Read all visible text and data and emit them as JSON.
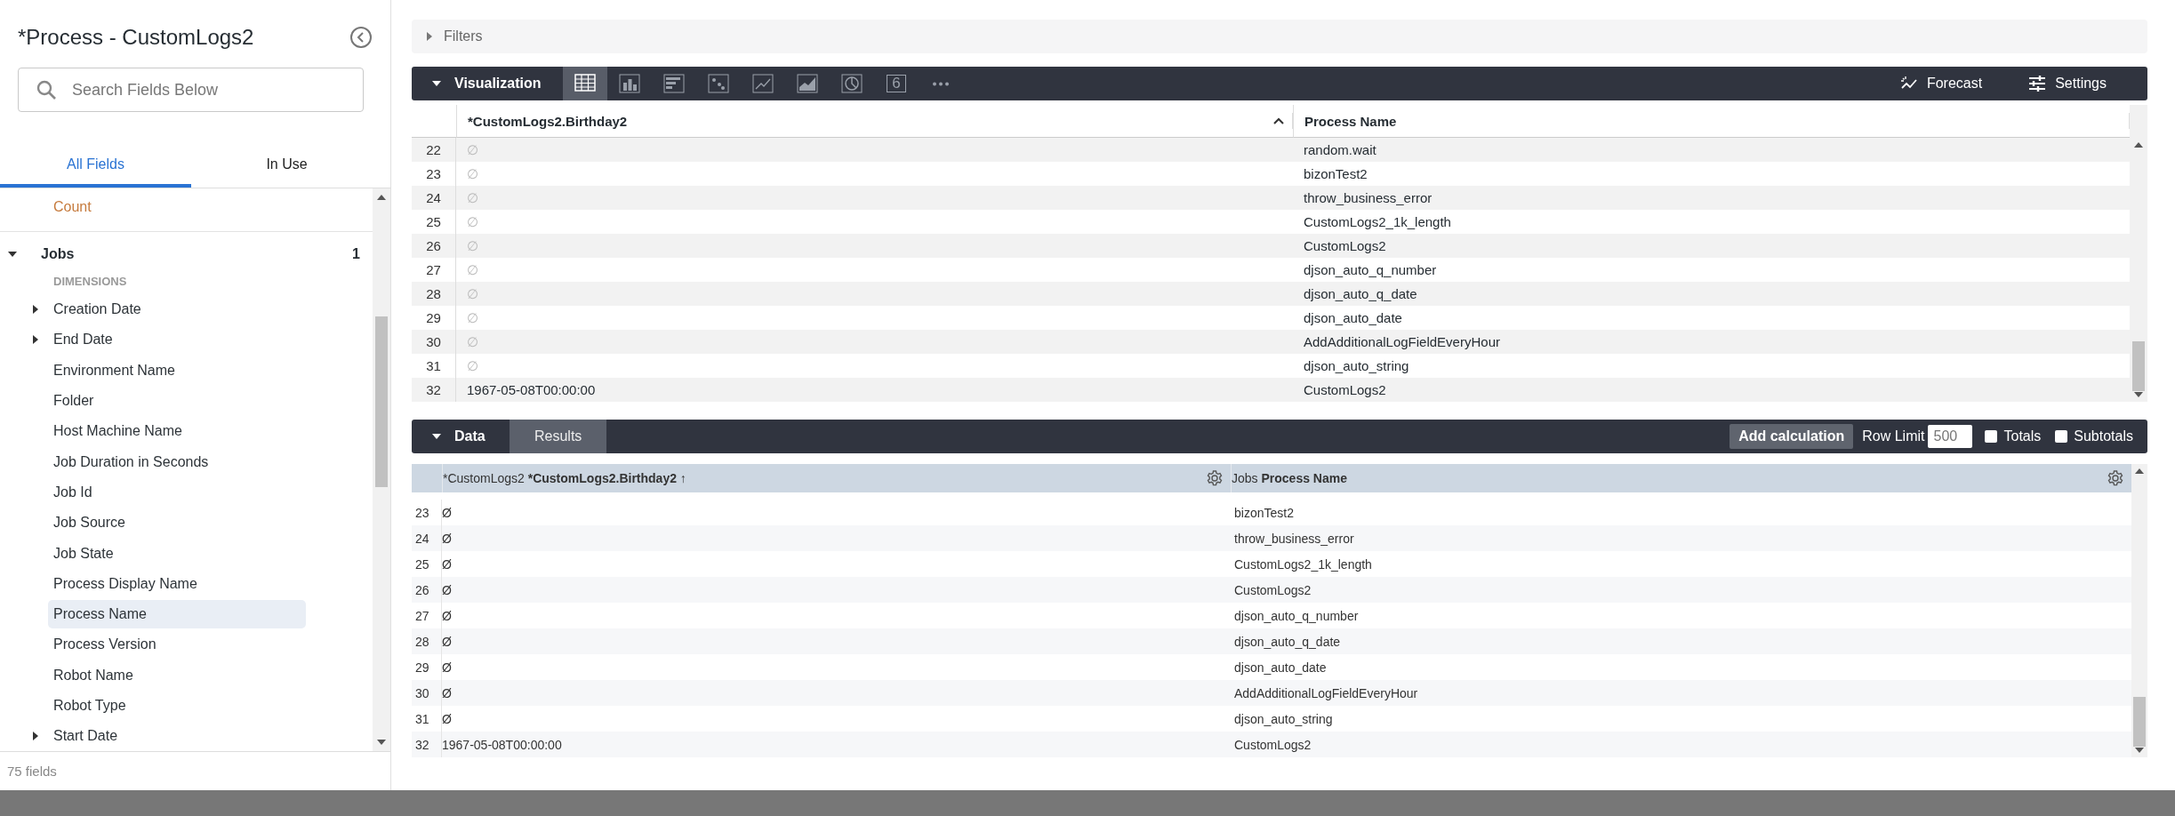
{
  "sidebar": {
    "title": "*Process - CustomLogs2",
    "search": {
      "placeholder": "Search Fields Below"
    },
    "tabs": [
      {
        "label": "All Fields",
        "selected": true
      },
      {
        "label": "In Use",
        "selected": false
      }
    ],
    "measure": "Count",
    "group": {
      "name": "Jobs",
      "count": "1",
      "expanded": true,
      "section": "DIMENSIONS",
      "items": [
        {
          "label": "Creation Date",
          "expandable": true,
          "selected": false
        },
        {
          "label": "End Date",
          "expandable": true,
          "selected": false
        },
        {
          "label": "Environment Name",
          "expandable": false,
          "selected": false
        },
        {
          "label": "Folder",
          "expandable": false,
          "selected": false
        },
        {
          "label": "Host Machine Name",
          "expandable": false,
          "selected": false
        },
        {
          "label": "Job Duration in Seconds",
          "expandable": false,
          "selected": false
        },
        {
          "label": "Job Id",
          "expandable": false,
          "selected": false
        },
        {
          "label": "Job Source",
          "expandable": false,
          "selected": false
        },
        {
          "label": "Job State",
          "expandable": false,
          "selected": false
        },
        {
          "label": "Process Display Name",
          "expandable": false,
          "selected": false
        },
        {
          "label": "Process Name",
          "expandable": false,
          "selected": true
        },
        {
          "label": "Process Version",
          "expandable": false,
          "selected": false
        },
        {
          "label": "Robot Name",
          "expandable": false,
          "selected": false
        },
        {
          "label": "Robot Type",
          "expandable": false,
          "selected": false
        },
        {
          "label": "Start Date",
          "expandable": true,
          "selected": false
        }
      ]
    },
    "footer": "75 fields"
  },
  "filters": {
    "label": "Filters",
    "expanded": false
  },
  "visualization": {
    "label": "Visualization",
    "expanded": true,
    "chart_types": [
      {
        "kind": "table",
        "selected": true
      },
      {
        "kind": "column",
        "selected": false
      },
      {
        "kind": "bar",
        "selected": false
      },
      {
        "kind": "scatter",
        "selected": false
      },
      {
        "kind": "line",
        "selected": false
      },
      {
        "kind": "area",
        "selected": false
      },
      {
        "kind": "pie",
        "selected": false
      },
      {
        "kind": "single_value",
        "label": "6",
        "selected": false
      },
      {
        "kind": "more",
        "selected": false
      }
    ],
    "actions": [
      {
        "kind": "forecast",
        "label": "Forecast"
      },
      {
        "kind": "settings",
        "label": "Settings"
      }
    ],
    "table": {
      "columns": [
        {
          "label": "*CustomLogs2.Birthday2",
          "sorted": true
        },
        {
          "label": "Process Name",
          "sorted": false
        }
      ],
      "rows": [
        {
          "index": "22",
          "column_1": "∅",
          "column_2": "random.wait"
        },
        {
          "index": "23",
          "column_1": "∅",
          "column_2": "bizonTest2"
        },
        {
          "index": "24",
          "column_1": "∅",
          "column_2": "throw_business_error"
        },
        {
          "index": "25",
          "column_1": "∅",
          "column_2": "CustomLogs2_1k_length"
        },
        {
          "index": "26",
          "column_1": "∅",
          "column_2": "CustomLogs2"
        },
        {
          "index": "27",
          "column_1": "∅",
          "column_2": "djson_auto_q_number"
        },
        {
          "index": "28",
          "column_1": "∅",
          "column_2": "djson_auto_q_date"
        },
        {
          "index": "29",
          "column_1": "∅",
          "column_2": "djson_auto_date"
        },
        {
          "index": "30",
          "column_1": "∅",
          "column_2": "AddAdditionalLogFieldEveryHour"
        },
        {
          "index": "31",
          "column_1": "∅",
          "column_2": "djson_auto_string"
        },
        {
          "index": "32",
          "column_1": "1967-05-08T00:00:00",
          "column_2": "CustomLogs2"
        }
      ]
    }
  },
  "data": {
    "label": "Data",
    "expanded": true,
    "tabs": [
      {
        "label": "Results",
        "selected": true
      }
    ],
    "add_calculation": "Add calculation",
    "row_limit": {
      "label": "Row Limit",
      "value": "500"
    },
    "options": [
      {
        "label": "Totals",
        "checked": false
      },
      {
        "label": "Subtotals",
        "checked": false
      }
    ],
    "table": {
      "columns": [
        {
          "view": "*CustomLogs2",
          "field": "*CustomLogs2.Birthday2",
          "sort_arrow": "↑"
        },
        {
          "view": "Jobs",
          "field": "Process Name"
        }
      ],
      "rows": [
        {
          "index": "23",
          "column_1": "Ø",
          "column_2": "bizonTest2"
        },
        {
          "index": "24",
          "column_1": "Ø",
          "column_2": "throw_business_error"
        },
        {
          "index": "25",
          "column_1": "Ø",
          "column_2": "CustomLogs2_1k_length"
        },
        {
          "index": "26",
          "column_1": "Ø",
          "column_2": "CustomLogs2"
        },
        {
          "index": "27",
          "column_1": "Ø",
          "column_2": "djson_auto_q_number"
        },
        {
          "index": "28",
          "column_1": "Ø",
          "column_2": "djson_auto_q_date"
        },
        {
          "index": "29",
          "column_1": "Ø",
          "column_2": "djson_auto_date"
        },
        {
          "index": "30",
          "column_1": "Ø",
          "column_2": "AddAdditionalLogFieldEveryHour"
        },
        {
          "index": "31",
          "column_1": "Ø",
          "column_2": "djson_auto_string"
        },
        {
          "index": "32",
          "column_1": "1967-05-08T00:00:00",
          "column_2": "CustomLogs2"
        }
      ]
    }
  }
}
